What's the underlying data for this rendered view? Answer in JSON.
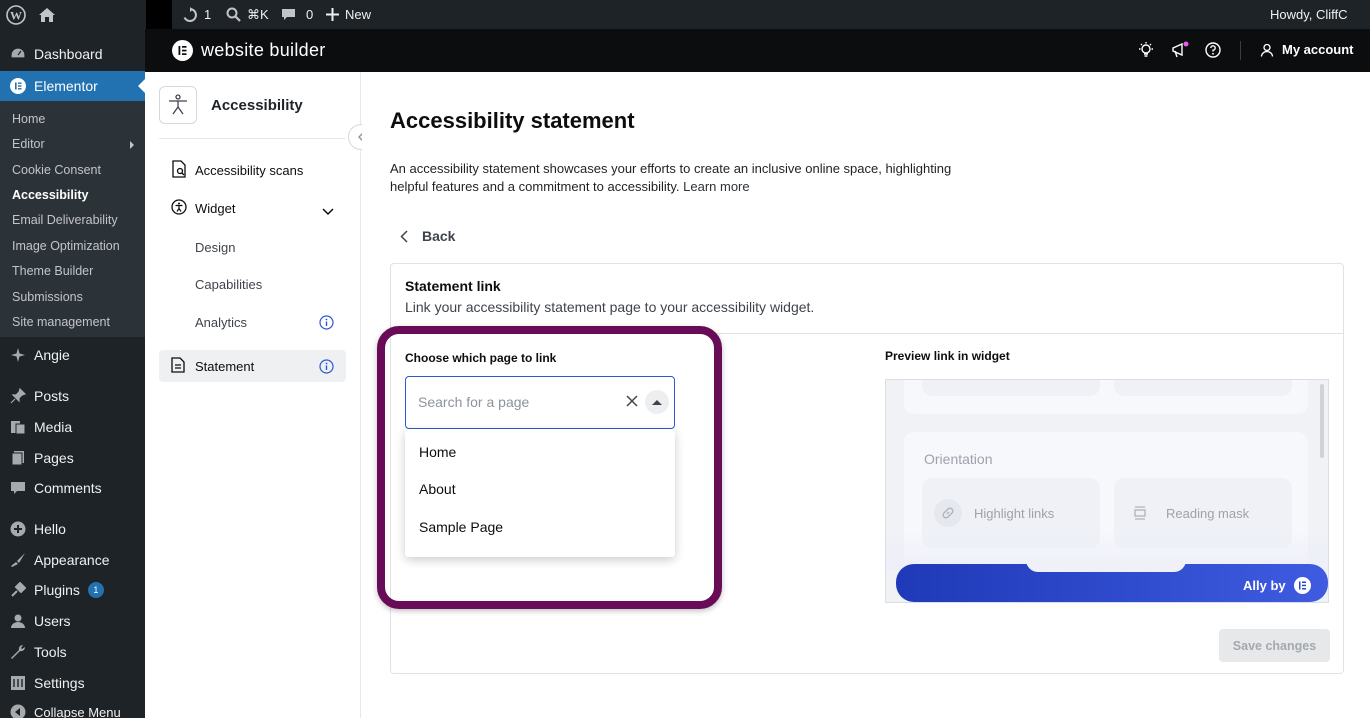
{
  "admin_bar": {
    "updates_count": "1",
    "search_shortcut": "⌘K",
    "comments_count": "0",
    "new_label": "New",
    "howdy": "Howdy, CliffC"
  },
  "wp_menu": {
    "dashboard": "Dashboard",
    "elementor": "Elementor",
    "sub": {
      "home": "Home",
      "editor": "Editor",
      "cookie": "Cookie Consent",
      "accessibility": "Accessibility",
      "email": "Email Deliverability",
      "image": "Image Optimization",
      "theme": "Theme Builder",
      "submissions": "Submissions",
      "site": "Site management"
    },
    "angie": "Angie",
    "posts": "Posts",
    "media": "Media",
    "pages": "Pages",
    "comments": "Comments",
    "hello": "Hello",
    "appearance": "Appearance",
    "plugins": "Plugins",
    "plugins_badge": "1",
    "users": "Users",
    "tools": "Tools",
    "settings": "Settings",
    "collapse": "Collapse Menu"
  },
  "header": {
    "brand": "website builder",
    "account": "My account"
  },
  "plugin_nav": {
    "title": "Accessibility",
    "scans": "Accessibility scans",
    "widget": "Widget",
    "design": "Design",
    "capabilities": "Capabilities",
    "analytics": "Analytics",
    "statement": "Statement"
  },
  "main": {
    "title": "Accessibility statement",
    "description": "An accessibility statement showcases your efforts to create an inclusive online space, highlighting helpful features and a commitment to accessibility.",
    "learn_more": "Learn more",
    "back": "Back",
    "card_title": "Statement link",
    "card_subtitle": "Link your accessibility statement page to your accessibility widget.",
    "choose_label": "Choose which page to link",
    "search_placeholder": "Search for a page",
    "options": [
      "Home",
      "About",
      "Sample Page"
    ],
    "preview_label": "Preview link in widget",
    "preview_section": "Orientation",
    "preview_btn1": "Highlight links",
    "preview_btn2": "Reading mask",
    "ally_by": "Ally by",
    "save": "Save changes"
  },
  "colors": {
    "wp_accent": "#2271b1",
    "highlight_border": "#680c57",
    "input_focus": "#2c59d1"
  }
}
